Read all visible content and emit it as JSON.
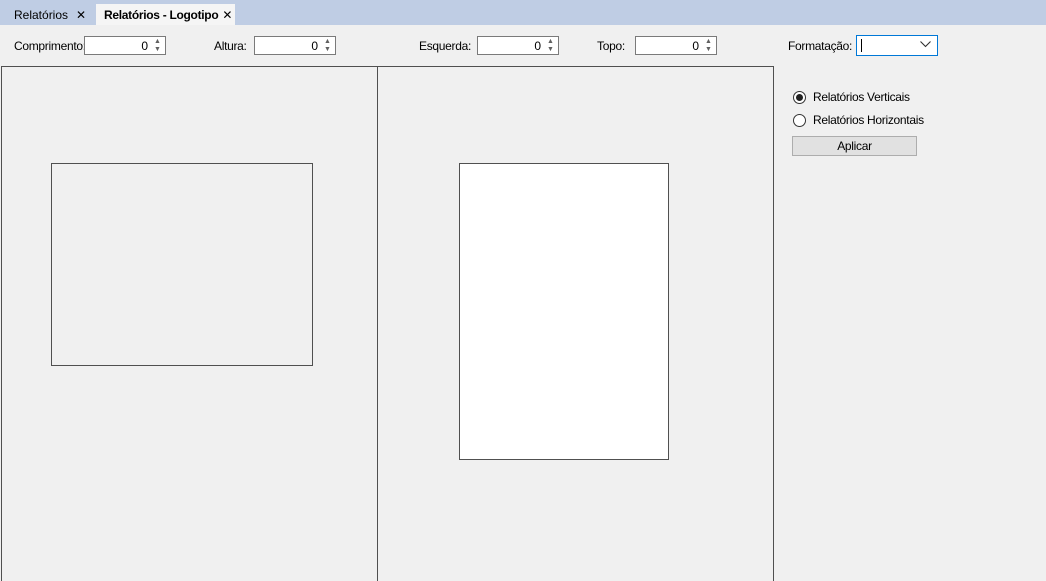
{
  "tabs": [
    {
      "label": "Relatórios",
      "close": "✕",
      "active": false
    },
    {
      "label": "Relatórios - Logotipo",
      "close": "✕",
      "active": true
    }
  ],
  "toolbar": {
    "width_label": "Comprimento:",
    "width_value": "0",
    "height_label": "Altura:",
    "height_value": "0",
    "left_label": "Esquerda:",
    "left_value": "0",
    "top_label": "Topo:",
    "top_value": "0",
    "format_label": "Formatação:",
    "format_value": ""
  },
  "options": {
    "vertical_label": "Relatórios Verticais",
    "vertical_selected": true,
    "horizontal_label": "Relatórios Horizontais",
    "horizontal_selected": false,
    "apply_label": "Aplicar"
  },
  "icons": {
    "spin_up": "▲",
    "spin_down": "▼",
    "dropdown": "chevron-down-icon"
  },
  "colors": {
    "tabstrip": "#bfcde4",
    "active_tab": "#f5f5f5",
    "focus_border": "#0078d7"
  }
}
